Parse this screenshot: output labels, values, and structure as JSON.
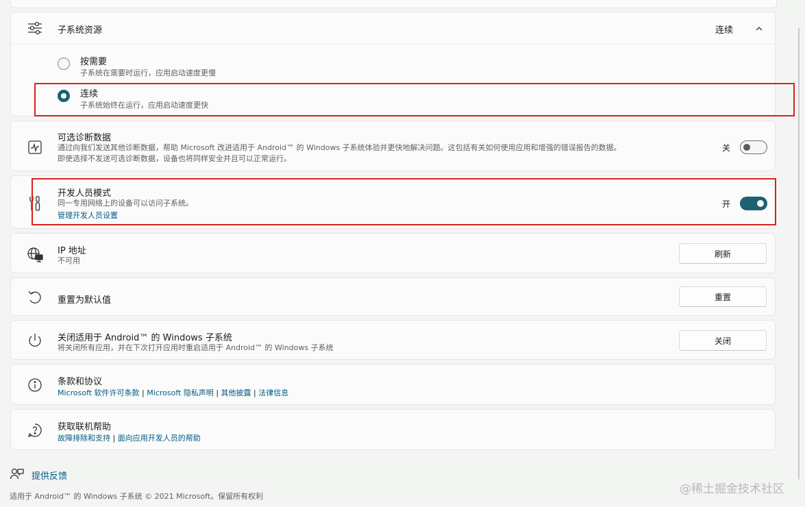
{
  "resources": {
    "title": "子系统资源",
    "current_value": "连续",
    "options": [
      {
        "label": "按需要",
        "description": "子系统在需要时运行，应用启动速度更慢",
        "selected": false
      },
      {
        "label": "连续",
        "description": "子系统始终在运行，应用启动速度更快",
        "selected": true
      }
    ]
  },
  "diagnostics": {
    "title": "可选诊断数据",
    "desc_line1": "通过向我们发送其他诊断数据，帮助 Microsoft 改进适用于 Android™ 的 Windows 子系统体验并更快地解决问题。这包括有关如何使用应用和增强的错误报告的数据。",
    "desc_line2": "即使选择不发送可选诊断数据，设备也将同样安全并且可以正常运行。",
    "state_label": "关",
    "enabled": false
  },
  "developer": {
    "title": "开发人员模式",
    "desc": "同一专用网络上的设备可以访问子系统。",
    "link": "管理开发人员设置",
    "state_label": "开",
    "enabled": true
  },
  "ip": {
    "title": "IP 地址",
    "value": "不可用",
    "button": "刷新"
  },
  "reset": {
    "title": "重置为默认值",
    "button": "重置"
  },
  "shutdown": {
    "title": "关闭适用于 Android™ 的 Windows 子系统",
    "desc": "将关闭所有应用，并在下次打开应用时重启适用于 Android™ 的 Windows 子系统",
    "button": "关闭"
  },
  "terms": {
    "title": "条款和协议",
    "links": [
      "Microsoft 软件许可条款",
      "Microsoft 隐私声明",
      "其他披露",
      "法律信息"
    ],
    "separator": " | "
  },
  "help": {
    "title": "获取联机帮助",
    "links": [
      "故障排除和支持",
      "面向应用开发人员的帮助"
    ],
    "separator": " | "
  },
  "footer": {
    "feedback": "提供反馈",
    "copyright": "适用于 Android™ 的 Windows 子系统 © 2021 Microsoft。保留所有权利"
  },
  "watermark": "@稀土掘金技术社区",
  "colors": {
    "accent": "#1e6170",
    "link": "#005b82",
    "highlight": "#d9211c"
  },
  "icons": {
    "resources": "sliders-icon",
    "diagnostics": "pulse-icon",
    "developer": "tools-icon",
    "ip": "globe-monitor-icon",
    "reset": "undo-icon",
    "shutdown": "power-icon",
    "terms": "info-icon",
    "help": "help-icon",
    "feedback": "feedback-icon",
    "chevron": "chevron-up-icon"
  }
}
